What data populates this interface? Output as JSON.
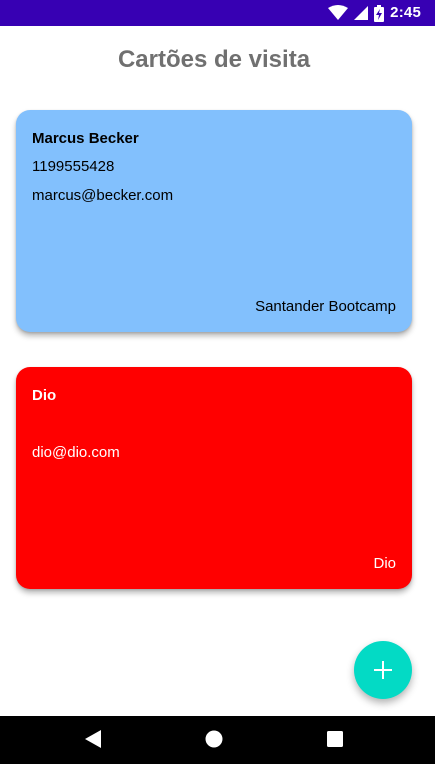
{
  "status_bar": {
    "time": "2:45",
    "icons": [
      "wifi-icon",
      "signal-icon",
      "battery-charging-icon"
    ],
    "background": "#3700b3"
  },
  "header": {
    "title": "Cartões de visita"
  },
  "cards": [
    {
      "name": "Marcus Becker",
      "phone": "1199555428",
      "email": "marcus@becker.com",
      "company": "Santander Bootcamp",
      "background": "#82c0fd",
      "text_color": "#000000"
    },
    {
      "name": "Dio",
      "phone": "",
      "email": "dio@dio.com",
      "company": "Dio",
      "background": "#ff0000",
      "text_color": "#ffffff"
    }
  ],
  "fab": {
    "icon": "plus-icon",
    "color": "#03dac5"
  },
  "nav_bar": {
    "buttons": [
      "back-icon",
      "home-icon",
      "recents-icon"
    ]
  }
}
